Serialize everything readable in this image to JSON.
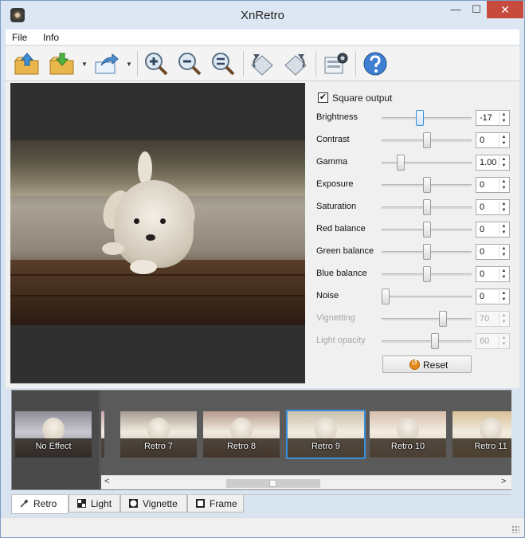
{
  "window": {
    "title": "XnRetro",
    "minimize_glyph": "—",
    "maximize_glyph": "☐",
    "close_glyph": "✕"
  },
  "menu": {
    "items": [
      {
        "label": "File"
      },
      {
        "label": "Info"
      }
    ]
  },
  "toolbar": {
    "buttons": [
      {
        "icon": "open-folder-icon"
      },
      {
        "icon": "save-folder-icon",
        "has_dropdown": true
      },
      {
        "icon": "share-icon",
        "has_dropdown": true
      },
      {
        "icon": "zoom-in-icon"
      },
      {
        "icon": "zoom-out-icon"
      },
      {
        "icon": "zoom-fit-icon"
      },
      {
        "icon": "rotate-left-icon"
      },
      {
        "icon": "rotate-right-icon"
      },
      {
        "icon": "screen-capture-icon"
      },
      {
        "icon": "help-icon"
      }
    ]
  },
  "controls": {
    "square_output": {
      "label": "Square output",
      "checked": true,
      "check_glyph": "✔"
    },
    "sliders": [
      {
        "label": "Brightness",
        "value": "-17",
        "level": 0.42,
        "enabled": true,
        "active": true
      },
      {
        "label": "Contrast",
        "value": "0",
        "level": 0.5,
        "enabled": true
      },
      {
        "label": "Gamma",
        "value": "1.00",
        "level": 0.18,
        "enabled": true
      },
      {
        "label": "Exposure",
        "value": "0",
        "level": 0.5,
        "enabled": true
      },
      {
        "label": "Saturation",
        "value": "0",
        "level": 0.5,
        "enabled": true
      },
      {
        "label": "Red balance",
        "value": "0",
        "level": 0.5,
        "enabled": true
      },
      {
        "label": "Green balance",
        "value": "0",
        "level": 0.5,
        "enabled": true
      },
      {
        "label": "Blue balance",
        "value": "0",
        "level": 0.5,
        "enabled": true
      },
      {
        "label": "Noise",
        "value": "0",
        "level": 0.0,
        "enabled": true
      },
      {
        "label": "Vignetting",
        "value": "70",
        "level": 0.7,
        "enabled": false
      },
      {
        "label": "Light opacity",
        "value": "60",
        "level": 0.6,
        "enabled": false
      }
    ],
    "spin_up": "▲",
    "spin_down": "▼",
    "reset_label": "Reset"
  },
  "effects": {
    "no_effect_label": "No Effect",
    "thumbnails": [
      {
        "label": "",
        "tone": "#c9a7ad"
      },
      {
        "label": "Retro 7",
        "tone": "#a69c91"
      },
      {
        "label": "Retro 8",
        "tone": "#b49a8c"
      },
      {
        "label": "Retro 9",
        "tone": "#c9c0ae",
        "selected": true
      },
      {
        "label": "Retro 10",
        "tone": "#d6bfae"
      },
      {
        "label": "Retro 11",
        "tone": "#d8c096"
      }
    ],
    "scroll_left": "<",
    "scroll_right": ">",
    "selected_color": "#3b8fd8"
  },
  "tabs": [
    {
      "label": "Retro",
      "icon": "magic-wand-icon",
      "active": true
    },
    {
      "label": "Light",
      "icon": "light-filter-icon"
    },
    {
      "label": "Vignette",
      "icon": "vignette-icon"
    },
    {
      "label": "Frame",
      "icon": "frame-icon"
    }
  ]
}
